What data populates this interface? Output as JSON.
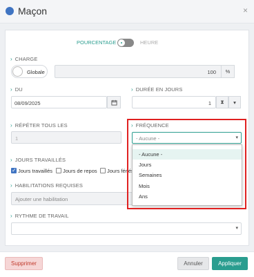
{
  "header": {
    "title": "Maçon",
    "close_label": "×"
  },
  "toggle": {
    "left_label": "POURCENTAGE",
    "right_label": "HEURE"
  },
  "charge": {
    "label": "CHARGE",
    "mode_label": "Globale",
    "value": "100",
    "unit": "%"
  },
  "du": {
    "label": "DU",
    "value": "08/09/2025"
  },
  "duree": {
    "label": "DURÉE EN JOURS",
    "value": "1",
    "unit_icon": "⧗",
    "caret": "▾"
  },
  "repeter": {
    "label": "RÉPÉTER TOUS LES",
    "value": "1"
  },
  "frequence": {
    "label": "FRÉQUENCE",
    "selected": "- Aucune -",
    "options": [
      "- Aucune -",
      "Jours",
      "Semaines",
      "Mois",
      "Ans"
    ]
  },
  "jours": {
    "label": "JOURS TRAVAILLÉS",
    "options": [
      "Jours travaillés",
      "Jours de repos",
      "Jours fériés"
    ],
    "checked": [
      true,
      false,
      false
    ]
  },
  "habilitations": {
    "label": "HABILITATIONS REQUISES",
    "placeholder": "Ajouter une habilitation"
  },
  "rythme": {
    "label": "RYTHME DE TRAVAIL",
    "value": "",
    "caret": "▾"
  },
  "footer": {
    "delete_label": "Supprimer",
    "cancel_label": "Annuler",
    "apply_label": "Appliquer"
  },
  "colors": {
    "accent": "#2a9d8f",
    "brand": "#3f74c2",
    "danger": "#e02020",
    "delete_bg": "#f6d6d6"
  }
}
